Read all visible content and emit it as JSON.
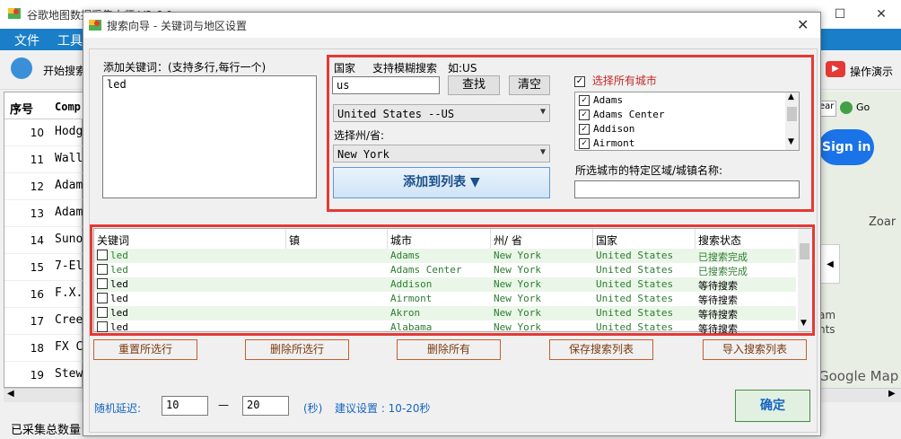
{
  "bg": {
    "title": "谷歌地图数据采集大师 V3.6.9",
    "menu": [
      "文件",
      "工具"
    ],
    "toolbar_start": "开始搜索",
    "toolbar_demo": "操作演示",
    "col_seq": "序号",
    "col_comp": "Comp",
    "rows": [
      {
        "n": "10",
        "name": "Hodg"
      },
      {
        "n": "11",
        "name": "Wall"
      },
      {
        "n": "12",
        "name": "Adam"
      },
      {
        "n": "13",
        "name": "Adam"
      },
      {
        "n": "14",
        "name": "Suno"
      },
      {
        "n": "15",
        "name": "7-El"
      },
      {
        "n": "16",
        "name": "F.X."
      },
      {
        "n": "17",
        "name": "Cree"
      },
      {
        "n": "18",
        "name": "FX C"
      },
      {
        "n": "19",
        "name": "Stew"
      }
    ],
    "status": "已采集总数量：",
    "map_go": "Go",
    "map_ear": "ear",
    "map_signin": "Sign in",
    "map_zoar": "Zoar",
    "map_am": "am",
    "map_hts": "hts",
    "map_google": "Google Map"
  },
  "dialog": {
    "title": "搜索向导 - 关键词与地区设置",
    "keywords_label": "添加关键词：(支持多行,每行一个)",
    "keywords_value": "led",
    "country_header": "国家",
    "fuzzy_label": "支持模糊搜索",
    "example_label": "如:US",
    "country_input": "us",
    "search_btn": "查找",
    "clear_btn": "清空",
    "country_select": "United States --US",
    "state_label": "选择州/省:",
    "state_select": "New York",
    "add_btn": "添加到列表 ▼",
    "select_all_label": "选择所有城市",
    "cities": [
      "Adams",
      "Adams Center",
      "Addison",
      "Airmont"
    ],
    "district_label": "所选城市的特定区域/城镇名称:",
    "district_value": "",
    "table_headers": [
      "关键词",
      "镇",
      "城市",
      "州/ 省",
      "国家",
      "搜索状态"
    ],
    "table_rows": [
      {
        "kw": "led",
        "town": "",
        "city": "Adams",
        "state": "New York",
        "country": "United States",
        "status": "已搜索完成",
        "done": true
      },
      {
        "kw": "led",
        "town": "",
        "city": "Adams Center",
        "state": "New York",
        "country": "United States",
        "status": "已搜索完成",
        "done": true
      },
      {
        "kw": "led",
        "town": "",
        "city": "Addison",
        "state": "New York",
        "country": "United States",
        "status": "等待搜索",
        "done": false
      },
      {
        "kw": "led",
        "town": "",
        "city": "Airmont",
        "state": "New York",
        "country": "United States",
        "status": "等待搜索",
        "done": false
      },
      {
        "kw": "led",
        "town": "",
        "city": "Akron",
        "state": "New York",
        "country": "United States",
        "status": "等待搜索",
        "done": false
      },
      {
        "kw": "led",
        "town": "",
        "city": "Alabama",
        "state": "New York",
        "country": "United States",
        "status": "等待搜索",
        "done": false
      }
    ],
    "actions": [
      "重置所选行",
      "删除所选行",
      "删除所有",
      "保存搜索列表",
      "导入搜索列表"
    ],
    "delay_label": "随机延迟:",
    "delay_min": "10",
    "delay_dash": "—",
    "delay_max": "20",
    "delay_unit": "(秒)",
    "delay_hint": "建议设置 : 10-20秒",
    "ok_btn": "确定"
  },
  "colors": {
    "accent": "#1a7fc8",
    "red_frame": "#e53935",
    "done_green": "#2e7d32",
    "blue_label": "#1565c0"
  }
}
